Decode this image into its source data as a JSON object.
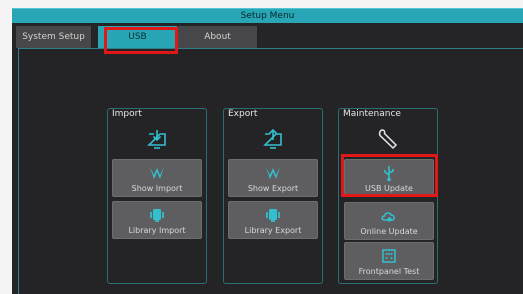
{
  "window": {
    "title": "Setup Menu"
  },
  "tabs": [
    {
      "label": "System Setup",
      "active": false
    },
    {
      "label": "USB",
      "active": true
    },
    {
      "label": "About",
      "active": false
    }
  ],
  "groups": {
    "import": {
      "title": "Import",
      "icon": "monitor-import-icon",
      "buttons": [
        {
          "label": "Show Import",
          "icon": "show-logo-icon"
        },
        {
          "label": "Library Import",
          "icon": "library-fixture-icon"
        }
      ]
    },
    "export": {
      "title": "Export",
      "icon": "monitor-export-icon",
      "buttons": [
        {
          "label": "Show Export",
          "icon": "show-logo-icon"
        },
        {
          "label": "Library Export",
          "icon": "library-fixture-icon"
        }
      ]
    },
    "maintenance": {
      "title": "Maintenance",
      "icon": "wrench-icon",
      "buttons": [
        {
          "label": "USB Update",
          "icon": "usb-icon"
        },
        {
          "label": "Online Update",
          "icon": "cloud-update-icon"
        },
        {
          "label": "Frontpanel Test",
          "icon": "frontpanel-icon"
        }
      ]
    }
  },
  "colors": {
    "accent": "#28a6b6",
    "highlight": "#e01818",
    "background": "#252527",
    "button": "#5e5e61"
  }
}
